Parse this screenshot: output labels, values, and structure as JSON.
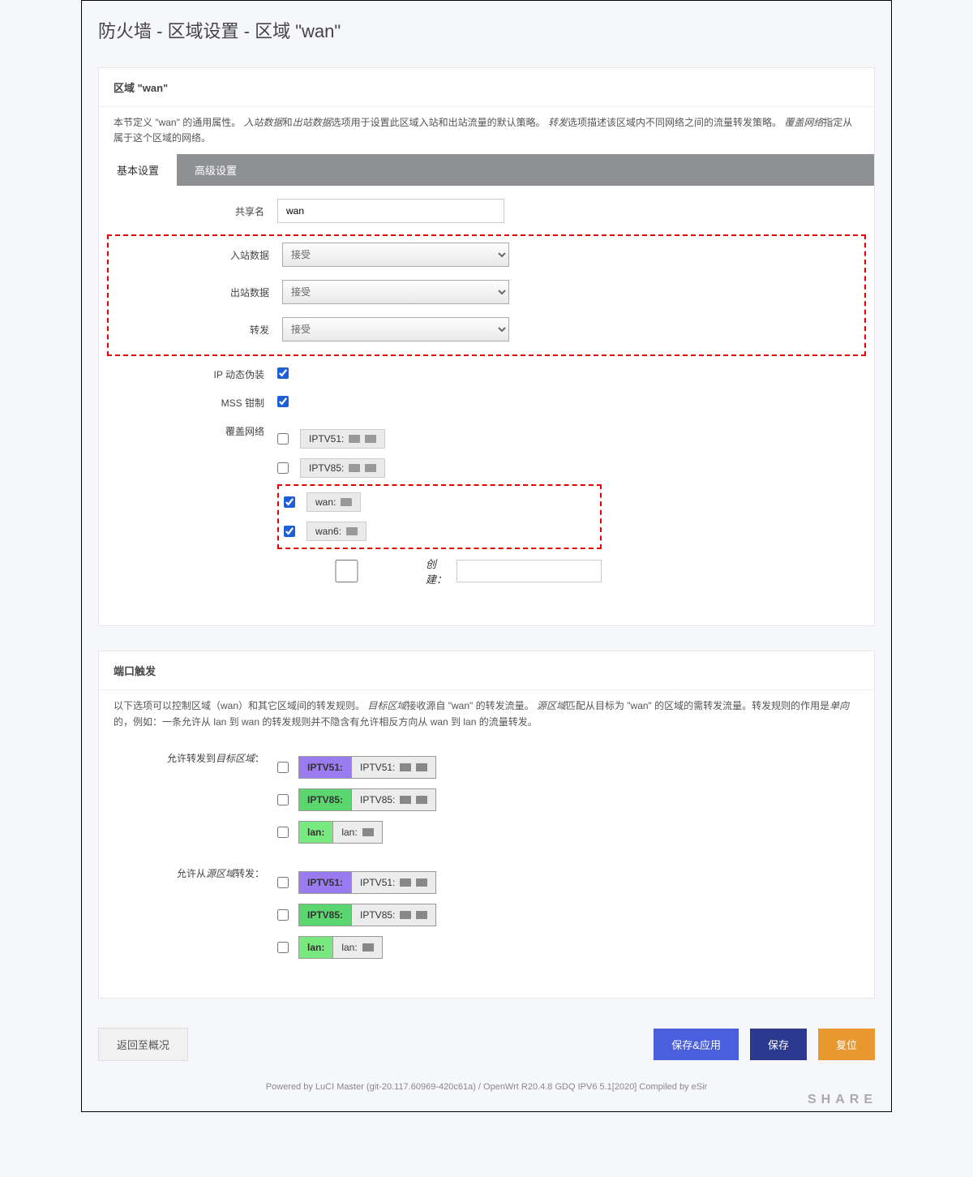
{
  "page_title": "防火墙 - 区域设置 - 区域 \"wan\"",
  "zone_panel": {
    "title": "区域 \"wan\"",
    "description_parts": {
      "p1": "本节定义 \"wan\" 的通用属性。",
      "em1": "入站数据",
      "p2": "和",
      "em2": "出站数据",
      "p3": "选项用于设置此区域入站和出站流量的默认策略。",
      "em3": "转发",
      "p4": "选项描述该区域内不同网络之间的流量转发策略。",
      "em4": "覆盖网络",
      "p5": "指定从属于这个区域的网络。"
    }
  },
  "tabs": {
    "basic": "基本设置",
    "advanced": "高级设置"
  },
  "form": {
    "name_label": "共享名",
    "name_value": "wan",
    "input_label": "入站数据",
    "output_label": "出站数据",
    "forward_label": "转发",
    "accept_option": "接受",
    "masq_label": "IP 动态伪装",
    "mss_label": "MSS 钳制",
    "networks_label": "覆盖网络",
    "create_label": "创建：",
    "networks": {
      "iptv51": "IPTV51:",
      "iptv85": "IPTV85:",
      "wan": "wan:",
      "wan6": "wan6:"
    }
  },
  "trigger_panel": {
    "title": "端口触发",
    "description_parts": {
      "p1": "以下选项可以控制区域（wan）和其它区域间的转发规则。",
      "em1": "目标区域",
      "p2": "接收源自 \"wan\" 的转发流量。",
      "em2": "源区域",
      "p3": "匹配从目标为 \"wan\" 的区域的需转发流量。转发规则的作用是",
      "em3": "单向",
      "p4": "的，例如：一条允许从 lan 到 wan 的转发规则并不隐含有允许相反方向从 wan 到 lan 的流量转发。"
    },
    "dest_label": "允许转发到目标区域：",
    "src_label": "允许从源区域转发：",
    "zones": {
      "iptv51": {
        "name": "IPTV51:",
        "box": "IPTV51:"
      },
      "iptv85": {
        "name": "IPTV85:",
        "box": "IPTV85:"
      },
      "lan": {
        "name": "lan:",
        "box": "lan:"
      }
    }
  },
  "buttons": {
    "back": "返回至概况",
    "save_apply": "保存&应用",
    "save": "保存",
    "reset": "复位"
  },
  "powered": "Powered by LuCI Master (git-20.117.60969-420c61a) / OpenWrt R20.4.8 GDQ IPV6 5.1[2020] Compiled by eSir",
  "watermark": "SHARE"
}
